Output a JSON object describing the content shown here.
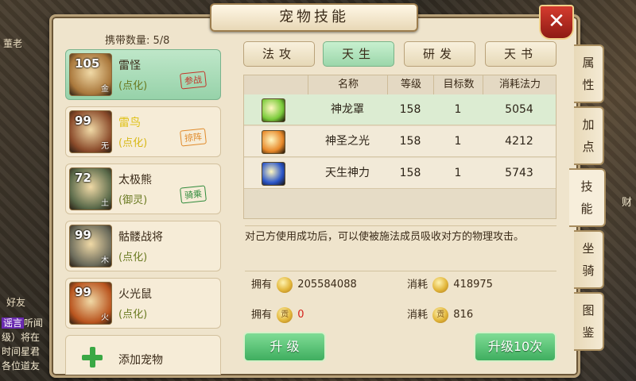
{
  "background": {
    "npc_name": "董老",
    "friend_label": "好友",
    "chat_tag": "谣言",
    "chat_lines": [
      "听闻",
      "级）将在",
      "时间星君",
      "各位道友"
    ],
    "right_text": "财"
  },
  "title": "宠物技能",
  "close_label": "✕",
  "pet_count": {
    "label": "携带数量:",
    "value": "5/8"
  },
  "pets": [
    {
      "level": "105",
      "element": "金",
      "name": "雷怪",
      "type": "(点化)",
      "stamp": "参战",
      "stamp_color": "red",
      "selected": true,
      "avatar_color": "#a9773b"
    },
    {
      "level": "99",
      "element": "无",
      "name": "雷鸟",
      "type": "(点化)",
      "stamp": "掠阵",
      "stamp_color": "orange",
      "selected": false,
      "avatar_color": "#8a4a2a"
    },
    {
      "level": "72",
      "element": "土",
      "name": "太极熊",
      "type": "(御灵)",
      "stamp": "骑乘",
      "stamp_color": "green",
      "selected": false,
      "avatar_color": "#5a6a4a"
    },
    {
      "level": "99",
      "element": "木",
      "name": "骷髅战将",
      "type": "(点化)",
      "stamp": "",
      "stamp_color": "",
      "selected": false,
      "avatar_color": "#6a6a5a"
    },
    {
      "level": "99",
      "element": "火",
      "name": "火光鼠",
      "type": "(点化)",
      "stamp": "",
      "stamp_color": "",
      "selected": false,
      "avatar_color": "#b9541e"
    }
  ],
  "add_pet_label": "添加宠物",
  "tabs": [
    "法攻",
    "天生",
    "研发",
    "天书"
  ],
  "active_tab": 1,
  "table": {
    "headers": [
      "名称",
      "等级",
      "目标数",
      "消耗法力"
    ],
    "rows": [
      {
        "name": "神龙罩",
        "level": "158",
        "targets": "1",
        "mana": "5054",
        "icon": "dragon-shield-icon",
        "icon_color": "#7acb3a"
      },
      {
        "name": "神圣之光",
        "level": "158",
        "targets": "1",
        "mana": "4212",
        "icon": "holy-light-icon",
        "icon_color": "#e8892a"
      },
      {
        "name": "天生神力",
        "level": "158",
        "targets": "1",
        "mana": "5743",
        "icon": "innate-power-icon",
        "icon_color": "#2a55c8"
      }
    ]
  },
  "description": "对己方使用成功后，可以使被施法成员吸收对方的物理攻击。",
  "costs": {
    "own_label": "拥有",
    "use_label": "消耗",
    "gold_own": "205584088",
    "gold_use": "418975",
    "tribute_own": "0",
    "tribute_use": "816",
    "tribute_glyph": "贡"
  },
  "buttons": {
    "upgrade": "升  级",
    "upgrade10": "升级10次"
  },
  "side_tabs": [
    {
      "label": "属性",
      "active": false
    },
    {
      "label": "加点",
      "active": false
    },
    {
      "label": "技能",
      "active": true
    },
    {
      "label": "坐骑",
      "active": false
    },
    {
      "label": "图鉴",
      "active": false
    }
  ]
}
